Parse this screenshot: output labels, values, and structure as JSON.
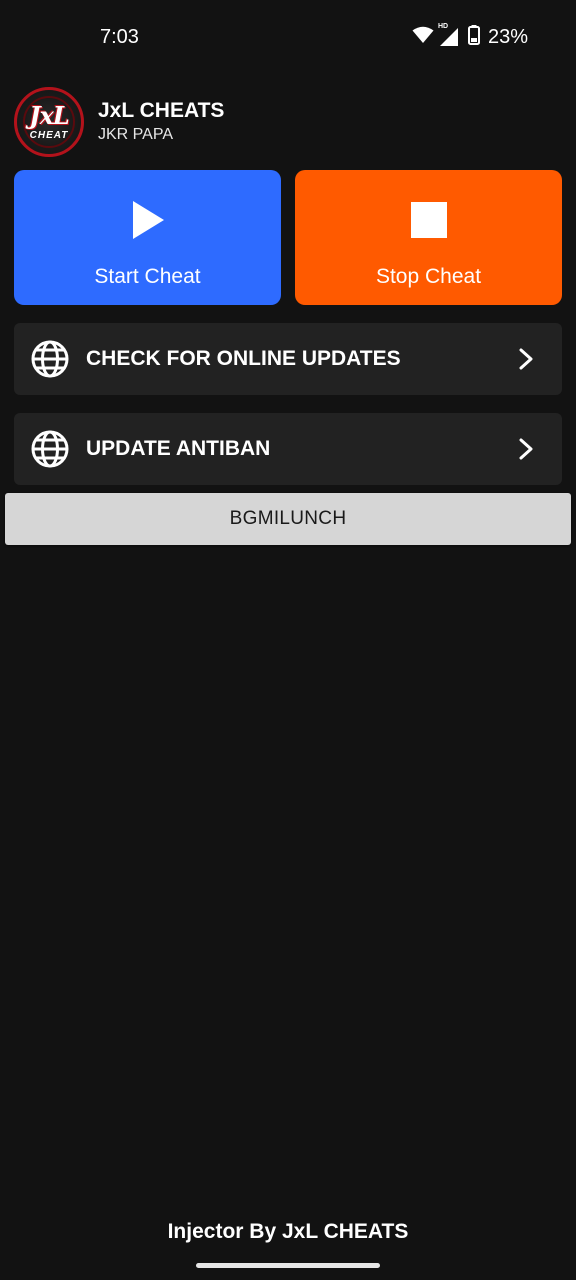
{
  "status_bar": {
    "time": "7:03",
    "battery": "23%",
    "network_badge": "HD",
    "icons": [
      "wifi-icon",
      "cellular-signal-icon",
      "battery-icon"
    ]
  },
  "header": {
    "logo_main": "JxL",
    "logo_sub": "CHEAT",
    "title": "JxL CHEATS",
    "subtitle": "JKR PAPA"
  },
  "actions": {
    "start": {
      "label": "Start Cheat",
      "icon": "play-icon",
      "color": "#2e6bff"
    },
    "stop": {
      "label": "Stop Cheat",
      "icon": "stop-icon",
      "color": "#ff5a00"
    }
  },
  "rows": [
    {
      "label": "CHECK FOR ONLINE UPDATES",
      "icon": "globe-icon"
    },
    {
      "label": "UPDATE ANTIBAN",
      "icon": "globe-icon"
    }
  ],
  "launch_button": {
    "label": "BGMILUNCH"
  },
  "footer": {
    "text": "Injector By JxL CHEATS"
  },
  "colors": {
    "background": "#121212",
    "row_background": "#222222",
    "launch_background": "#d6d6d6",
    "logo_accent": "#b3121b"
  }
}
